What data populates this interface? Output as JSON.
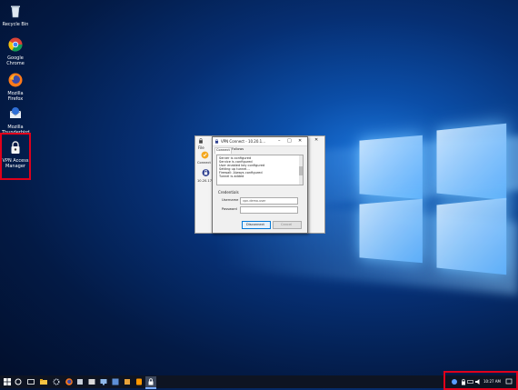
{
  "desktop": {
    "icons": [
      {
        "label": "Recycle Bin"
      },
      {
        "label": "Google Chrome"
      },
      {
        "label": "Mozilla Firefox"
      },
      {
        "label": "Mozilla Thunderbird"
      },
      {
        "label": "VPN Access Manager"
      }
    ]
  },
  "back_window": {
    "menu_file": "File",
    "connect_label": "Connect",
    "ip_label": "10.20.17..."
  },
  "vpn_dialog": {
    "title": "VPN Connect - 10.20.1...",
    "tabs": [
      "Connect",
      "Follows"
    ],
    "log_lines": [
      "Server is configured",
      "Service is configured",
      "User enabled key configured",
      "Setting up tunnel...",
      "Firewall: Always configured",
      "Tunnel is added"
    ],
    "credentials_heading": "Credentials",
    "username_label": "Username",
    "username_value": "vpn.demo.user",
    "password_label": "Password",
    "password_value": "",
    "disconnect_button": "Disconnect",
    "cancel_button": "Cancel"
  },
  "taskbar": {
    "start_icon": "windows-icon",
    "clock": "10:27 AM"
  },
  "colors": {
    "highlight": "#e0001b",
    "taskbar": "#0e1422",
    "wallpaper_glow": "#1a73d9"
  }
}
